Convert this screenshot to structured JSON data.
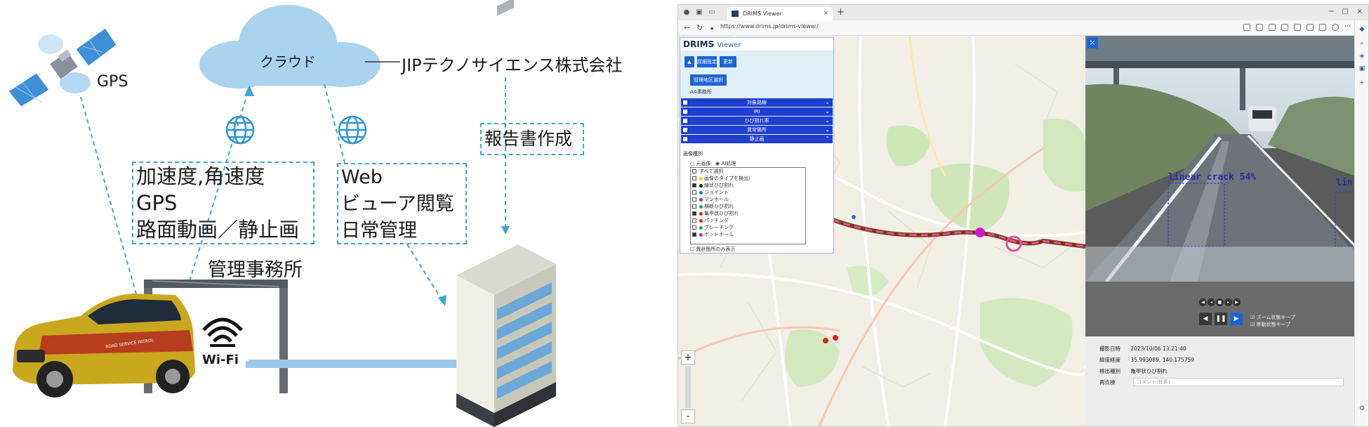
{
  "diagram": {
    "gps_label": "GPS",
    "cloud_label": "クラウド",
    "company": "JIPテクノサイエンス株式会社",
    "report_label": "報告書作成",
    "data_box_lines": [
      "加速度,角速度",
      "GPS",
      "路面動画／静止画"
    ],
    "web_box_lines": [
      "Web",
      "ビューア閲覧",
      "日常管理"
    ],
    "office_label": "管理事務所",
    "wifi_label": "Wi-Fi",
    "car_text": "ROAD SERVICE PATROL",
    "colors": {
      "accent": "#3fa6d6",
      "cloud": "#a8d4f0",
      "building_glass": "#6aa8d8"
    }
  },
  "browser": {
    "tab_title": "DRIMS Viewer",
    "url": "https://www.drims.jp/drims-viewer/",
    "window_controls": [
      "−",
      "□",
      "×"
    ]
  },
  "panel": {
    "logo": "DRIMS",
    "logo_sub": "Viewer",
    "buttons": [
      "詳細設定",
      "更新",
      "管理地区選択"
    ],
    "manage_area": "AA事務所",
    "sections": [
      {
        "label": "対象路線",
        "checked": false
      },
      {
        "label": "IRI",
        "checked": false
      },
      {
        "label": "ひび割れ率",
        "checked": false
      },
      {
        "label": "異常箇所",
        "checked": false
      },
      {
        "label": "静止画",
        "checked": true
      }
    ],
    "image_type_title": "画像種別",
    "radios": [
      "元画像",
      "AI処理"
    ],
    "list_items": [
      {
        "label": "すべて選択",
        "checked": false,
        "color": ""
      },
      {
        "label": "画像のタイプを検出）",
        "checked": false,
        "color": "#f5d000"
      },
      {
        "label": "線状ひび割れ",
        "checked": true,
        "color": "#222222"
      },
      {
        "label": "ジョイント",
        "checked": false,
        "color": "#2a6be0"
      },
      {
        "label": "マンホール",
        "checked": false,
        "color": "#7a2ad6"
      },
      {
        "label": "横断ひび割れ",
        "checked": false,
        "color": "#1aa84a"
      },
      {
        "label": "亀甲状ひび割れ",
        "checked": true,
        "color": "#e0201a"
      },
      {
        "label": "パッチング",
        "checked": false,
        "color": "#e0201a"
      },
      {
        "label": "グレーチング",
        "checked": false,
        "color": "#29a84a"
      },
      {
        "label": "ポットホール",
        "checked": true,
        "color": "#c22ad6"
      }
    ],
    "hide_only": "異状箇所のみ表示"
  },
  "map": {
    "zoom_in": "+",
    "zoom_out": "-"
  },
  "video": {
    "close": "×",
    "detections": [
      "linear crack 54%",
      "lin"
    ],
    "playback": [
      "◀",
      "❚❚",
      "▶"
    ],
    "options": [
      "ズーム状態キープ",
      "移動状態キープ"
    ],
    "info": [
      {
        "key": "撮影日時",
        "value": "2023/10/06 13:21:40"
      },
      {
        "key": "緯度経度",
        "value": "35.993089, 140.175759"
      },
      {
        "key": "検出種別",
        "value": "亀甲状ひび割れ"
      },
      {
        "key": "再点検",
        "value": ""
      }
    ],
    "comment_placeholder": "コメント(任意)"
  }
}
